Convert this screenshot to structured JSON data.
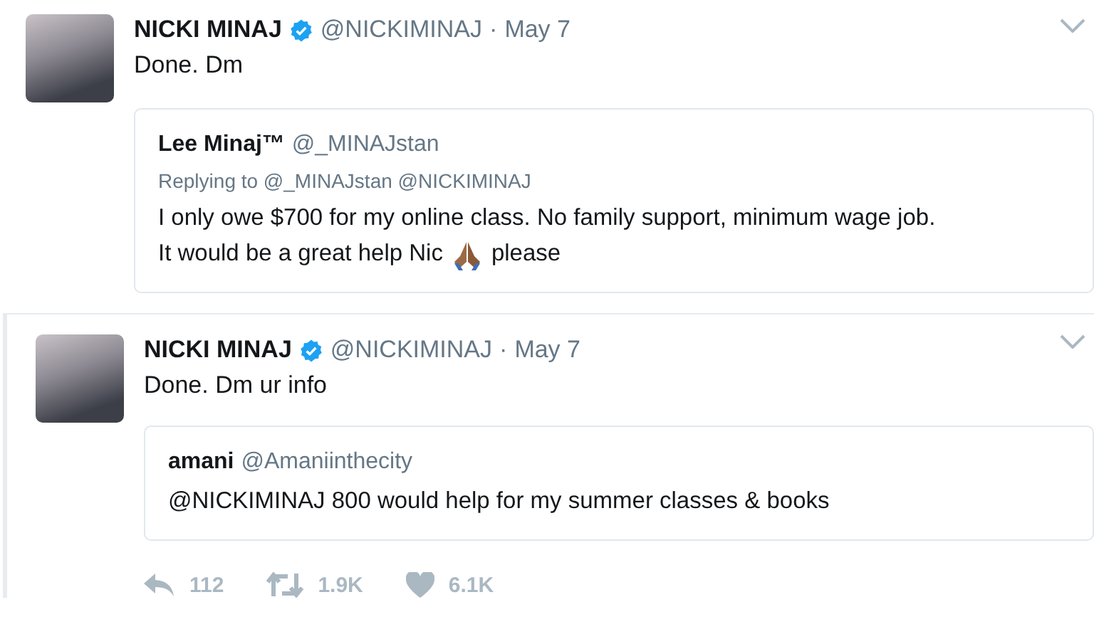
{
  "tweets": [
    {
      "author": {
        "name": "NICKI MINAJ",
        "verified": true,
        "handle": "@NICKIMINAJ",
        "separator": "·",
        "date": "May 7"
      },
      "text": "Done. Dm",
      "quote": {
        "name": "Lee Minaj™",
        "handle": "@_MINAJstan",
        "reply_to": "Replying to @_MINAJstan @NICKIMINAJ",
        "lines": [
          "I only owe $700 for my online class. No family support, minimum wage job.",
          "It would be a great help Nic"
        ],
        "after_icon": "please"
      }
    },
    {
      "author": {
        "name": "NICKI MINAJ",
        "verified": true,
        "handle": "@NICKIMINAJ",
        "separator": "·",
        "date": "May 7"
      },
      "text": "Done. Dm ur info",
      "quote": {
        "name": "amani",
        "handle": "@Amaniinthecity",
        "lines": [
          "@NICKIMINAJ 800 would help for my summer classes & books"
        ]
      },
      "actions": [
        {
          "kind": "reply",
          "count": "112"
        },
        {
          "kind": "retweet",
          "count": "1.9K"
        },
        {
          "kind": "like",
          "count": "6.1K"
        }
      ]
    }
  ]
}
